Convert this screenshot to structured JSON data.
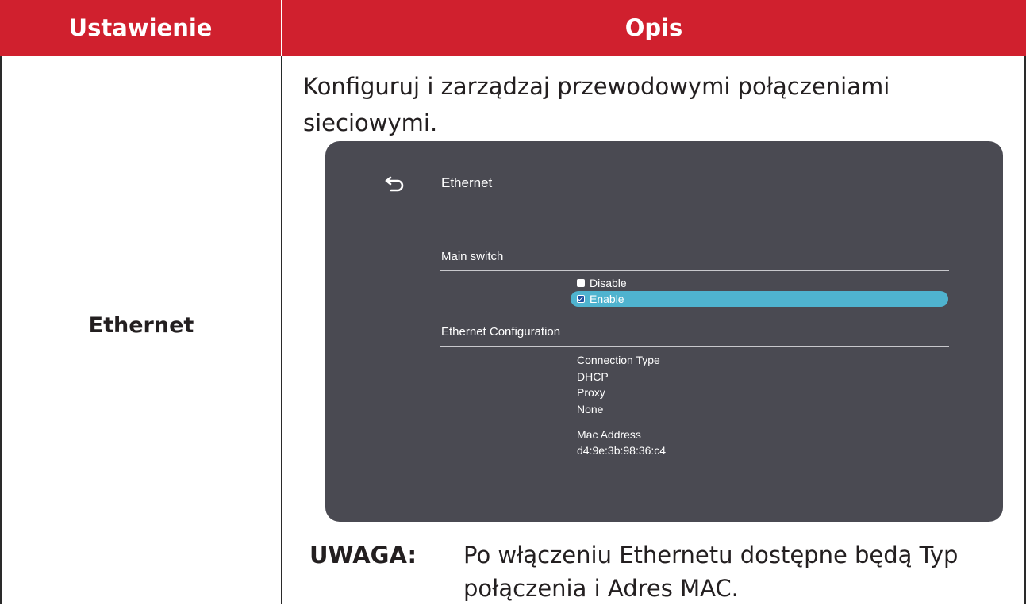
{
  "table": {
    "header_setting": "Ustawienie",
    "header_description": "Opis",
    "header_color": "#d0202e"
  },
  "row": {
    "setting": "Ethernet",
    "description": "Konfiguruj i zarządzaj przewodowymi połączeniami sieciowymi."
  },
  "screenshot": {
    "back_icon": "back-arrow-icon",
    "title": "Ethernet",
    "main_switch_label": "Main switch",
    "options": [
      {
        "label": "Disable",
        "selected": false
      },
      {
        "label": "Enable",
        "selected": true
      }
    ],
    "config_label": "Ethernet Configuration",
    "connection_type_label": "Connection Type",
    "connection_values": [
      "DHCP",
      "Proxy",
      "None"
    ],
    "mac_label": "Mac Address",
    "mac_value": "d4:9e:3b:98:36:c4",
    "highlight_color": "#4fb3cf"
  },
  "note": {
    "label": "UWAGA:",
    "text": "Po włączeniu Ethernetu dostępne będą Typ połączenia i Adres MAC."
  }
}
